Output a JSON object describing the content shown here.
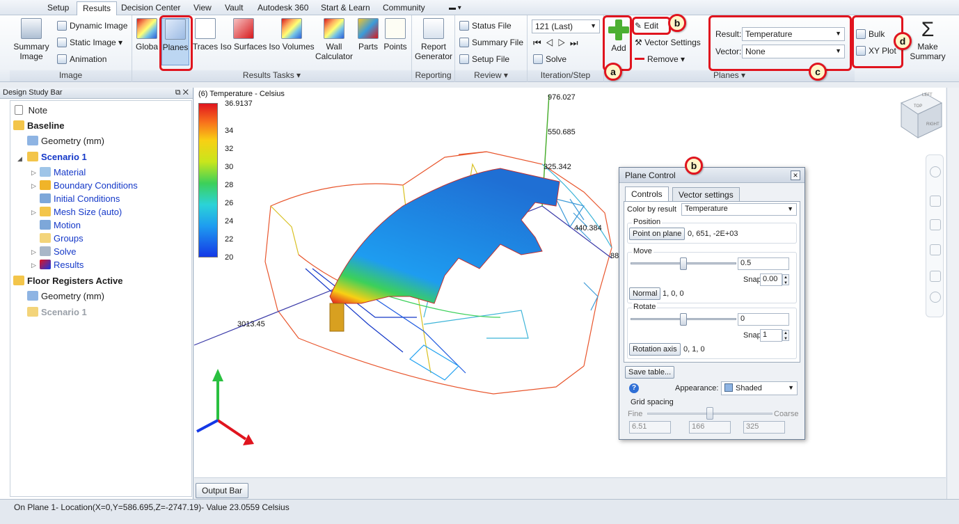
{
  "menu": {
    "tabs": [
      "Setup",
      "Results",
      "Decision Center",
      "View",
      "Vault",
      "Autodesk 360",
      "Start & Learn",
      "Community"
    ],
    "active": "Results"
  },
  "ribbon": {
    "image_group": {
      "label": "Image",
      "summary_image": "Summary Image",
      "dynamic_image": "Dynamic Image",
      "static_image": "Static Image",
      "animation": "Animation"
    },
    "results_tasks": {
      "label": "Results Tasks",
      "global": "Globa",
      "planes": "Planes",
      "traces": "Traces",
      "iso_surfaces": "Iso Surfaces",
      "iso_volumes": "Iso Volumes",
      "wall_calculator": "Wall Calculator",
      "parts": "Parts",
      "points": "Points"
    },
    "reporting": {
      "label": "Reporting",
      "report_generator": "Report Generator"
    },
    "review": {
      "label": "Review",
      "status_file": "Status File",
      "summary_file": "Summary File",
      "setup_file": "Setup File"
    },
    "iteration": {
      "label": "Iteration/Step",
      "selected": "121 (Last)",
      "solve": "Solve"
    },
    "planes_group": {
      "label": "Planes",
      "add": "Add",
      "edit": "Edit",
      "vector_settings": "Vector Settings",
      "remove": "Remove",
      "result_label": "Result:",
      "result_value": "Temperature",
      "vector_label": "Vector:",
      "vector_value": "None",
      "bulk": "Bulk",
      "xy_plot": "XY Plot",
      "make_summary": "Make Summary"
    }
  },
  "callouts": {
    "a": "a",
    "b": "b",
    "c": "c",
    "d": "d"
  },
  "design_study_bar": {
    "title": "Design Study Bar",
    "tree": {
      "note": "Note",
      "baseline": "Baseline",
      "geometry_1": "Geometry (mm)",
      "scenario_1": "Scenario 1",
      "material": "Material",
      "boundary_conditions": "Boundary Conditions",
      "initial_conditions": "Initial Conditions",
      "mesh_size": "Mesh Size (auto)",
      "motion": "Motion",
      "groups": "Groups",
      "solve": "Solve",
      "results": "Results",
      "floor_registers": "Floor Registers Active",
      "geometry_2": "Geometry (mm)",
      "scenario_2": "Scenario 1"
    }
  },
  "viewport": {
    "legend_title": "(6) Temperature - Celsius",
    "legend_ticks": [
      "36.9137",
      "34",
      "32",
      "30",
      "28",
      "26",
      "24",
      "22",
      "20"
    ],
    "axis_labels": [
      "976.027",
      "550.685",
      "325.342",
      "440.384",
      "3013.45",
      "88"
    ],
    "viewcube_top": "TOP",
    "viewcube_right": "RIGHT",
    "viewcube_left": "LEFT"
  },
  "plane_control": {
    "title": "Plane Control",
    "tabs": [
      "Controls",
      "Vector settings"
    ],
    "color_by_label": "Color by result",
    "color_by_value": "Temperature",
    "position_label": "Position",
    "point_on_plane_btn": "Point on plane",
    "point_on_plane_value": "0, 651, -2E+03",
    "move_label": "Move",
    "move_value": "0.5",
    "move_slider_value": 0.5,
    "snap_label": "Snap",
    "move_snap": "0.00",
    "normal_btn": "Normal",
    "normal_value": "1, 0, 0",
    "rotate_label": "Rotate",
    "rotate_value": "0",
    "rotate_slider_value": 0.5,
    "rotate_snap": "1",
    "rotation_axis_btn": "Rotation axis",
    "rotation_axis_value": "0, 1, 0",
    "save_table_btn": "Save table...",
    "appearance_label": "Appearance:",
    "appearance_value": "Shaded",
    "grid_spacing_label": "Grid spacing",
    "grid_fine": "Fine",
    "grid_coarse": "Coarse",
    "grid_slider_value": 0.5,
    "grid_values": [
      "6.51",
      "166",
      "325"
    ]
  },
  "output_bar": {
    "label": "Output Bar"
  },
  "status": {
    "text": "On Plane 1- Location(X=0,Y=586.695,Z=-2747.19)- Value  23.0559  Celsius"
  },
  "colors": {
    "callout_red": "#e0141e",
    "tree_blue": "#1438c8"
  }
}
